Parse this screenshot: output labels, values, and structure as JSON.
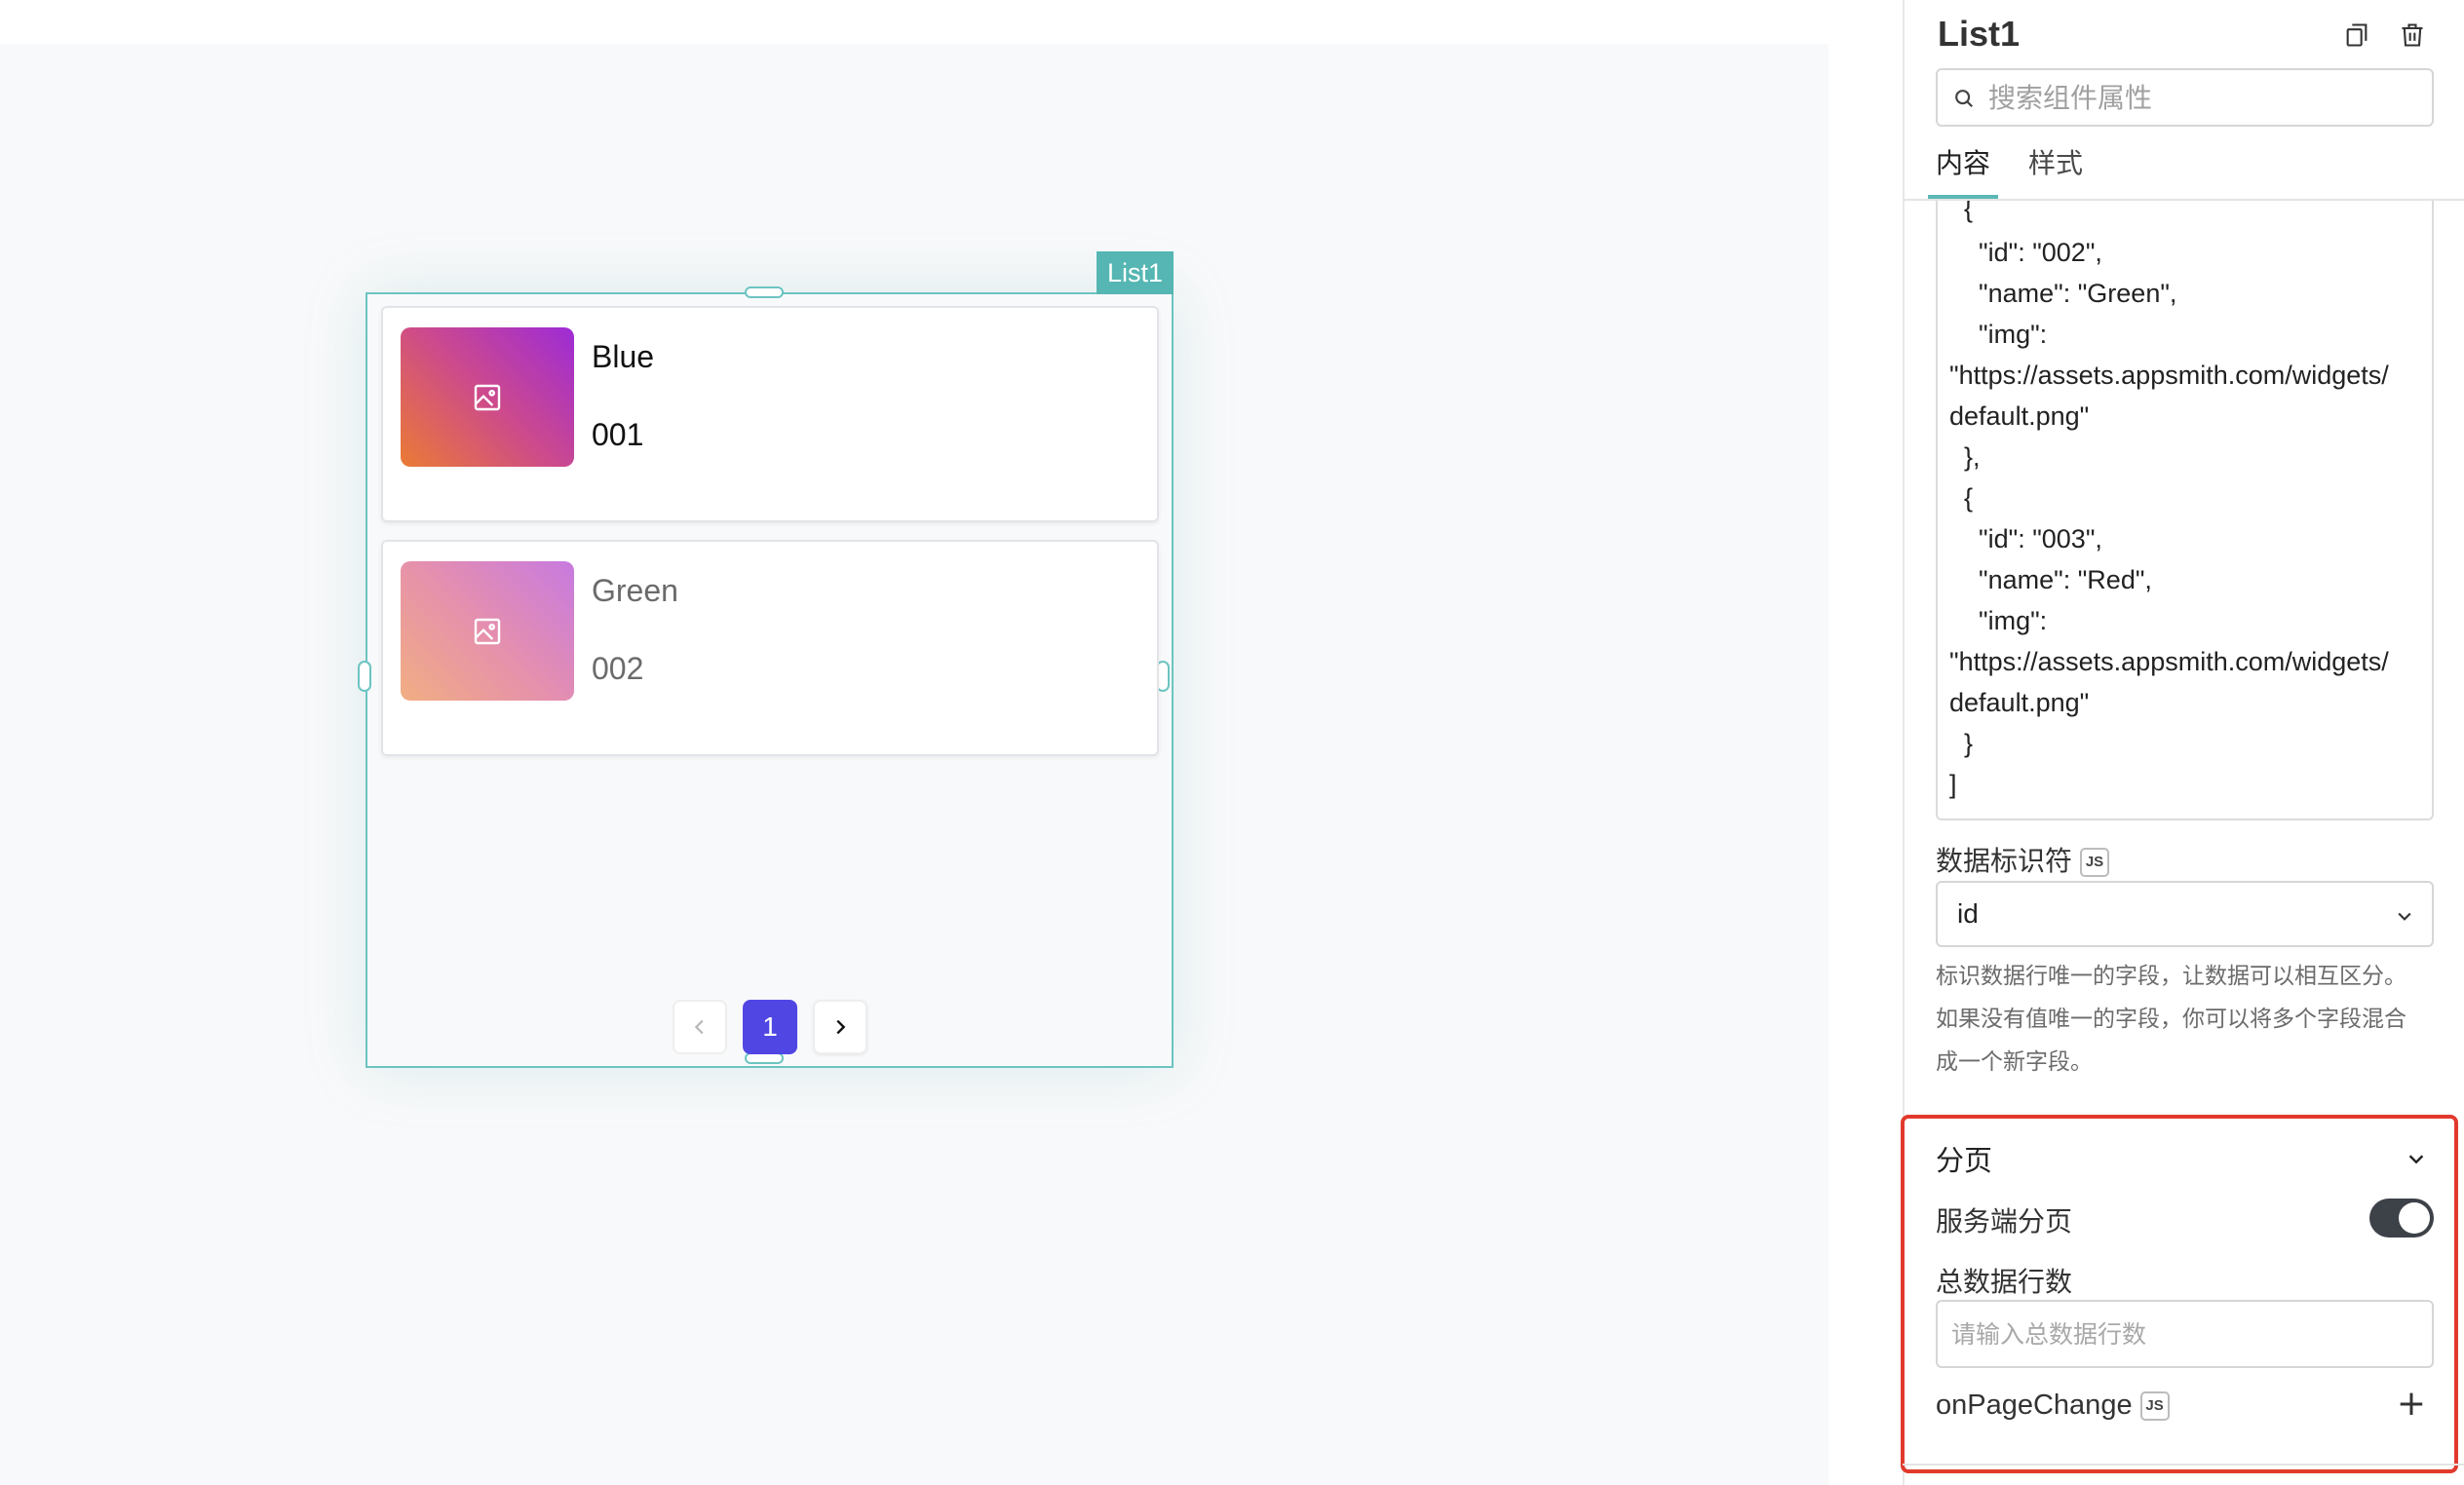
{
  "widget": {
    "tag": "List1",
    "items": [
      {
        "name": "Blue",
        "id": "001",
        "image_icon": "image-placeholder-icon"
      },
      {
        "name": "Green",
        "id": "002",
        "image_icon": "image-placeholder-icon"
      }
    ],
    "pagination": {
      "prev": "‹",
      "current": "1",
      "next": "›"
    }
  },
  "pane": {
    "title": "List1",
    "icons": {
      "copy": "copy-icon",
      "delete": "trash-icon"
    },
    "search": {
      "placeholder": "搜索组件属性"
    },
    "tabs": [
      {
        "label": "内容",
        "active": true
      },
      {
        "label": "样式",
        "active": false
      }
    ],
    "json_lines": [
      "  {",
      "    \"id\": \"002\",",
      "    \"name\": \"Green\",",
      "    \"img\":",
      "\"https://assets.appsmith.com/widgets/",
      "default.png\"",
      "  },",
      "  {",
      "    \"id\": \"003\",",
      "    \"name\": \"Red\",",
      "    \"img\":",
      "\"https://assets.appsmith.com/widgets/",
      "default.png\"",
      "  }",
      "]"
    ],
    "data_key": {
      "label": "数据标识符",
      "badge": "JS",
      "value": "id",
      "help": [
        "标识数据行唯一的字段，让数据可以相互区分。",
        "如果没有值唯一的字段，你可以将多个字段混合",
        "成一个新字段。"
      ]
    },
    "pagination_section": {
      "title": "分页",
      "server_side_label": "服务端分页",
      "server_side_enabled": true,
      "total_rows_label": "总数据行数",
      "total_rows_placeholder": "请输入总数据行数",
      "on_page_change_label": "onPageChange",
      "on_page_change_badge": "JS",
      "add_symbol": "+"
    }
  },
  "colors": {
    "selection": "#6cc4c2",
    "tag": "#55b6b3",
    "accent": "#5046e4",
    "highlight": "#e2392d",
    "toggle_on": "#3d4148"
  }
}
